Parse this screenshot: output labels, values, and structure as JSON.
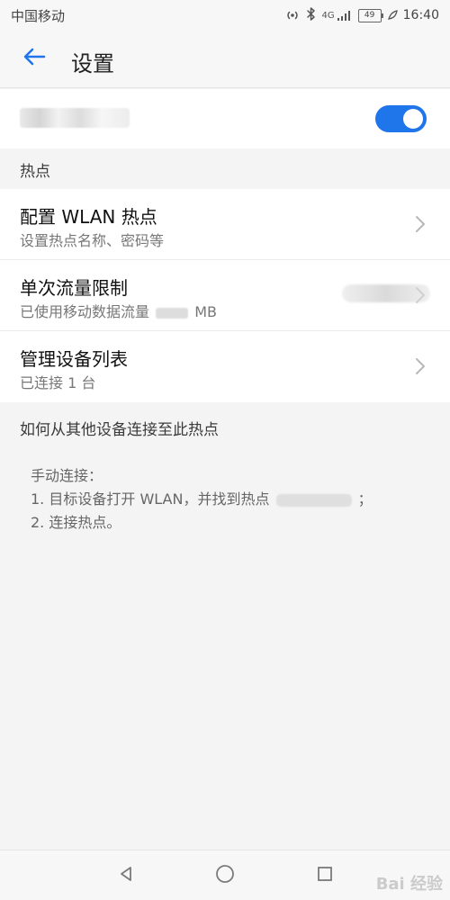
{
  "status_bar": {
    "carrier": "中国移动",
    "signal_label": "4G",
    "battery": "49",
    "time": "16:40"
  },
  "header": {
    "title": "设置"
  },
  "hotspot": {
    "toggle_on": true
  },
  "sections": {
    "hotspot_title": "热点",
    "connect_title": "如何从其他设备连接至此热点"
  },
  "settings_items": [
    {
      "title": "配置 WLAN 热点",
      "subtitle": "设置热点名称、密码等"
    },
    {
      "title": "单次流量限制",
      "subtitle_prefix": "已使用移动数据流量",
      "subtitle_suffix": "MB"
    },
    {
      "title": "管理设备列表",
      "subtitle": "已连接 1 台"
    }
  ],
  "help": {
    "line1": "手动连接：",
    "line2_prefix": "1. 目标设备打开 WLAN，并找到热点",
    "line2_suffix": "；",
    "line3": "2. 连接热点。"
  },
  "watermark": "Bai 经验",
  "icons": {
    "back": "back-arrow-icon",
    "chevron": "chevron-right-icon",
    "nav_back": "triangle-back-icon",
    "nav_home": "circle-home-icon",
    "nav_recent": "square-recent-icon"
  },
  "colors": {
    "accent": "#1f75ea",
    "page_background": "#f4f4f4",
    "list_background": "#ffffff"
  }
}
